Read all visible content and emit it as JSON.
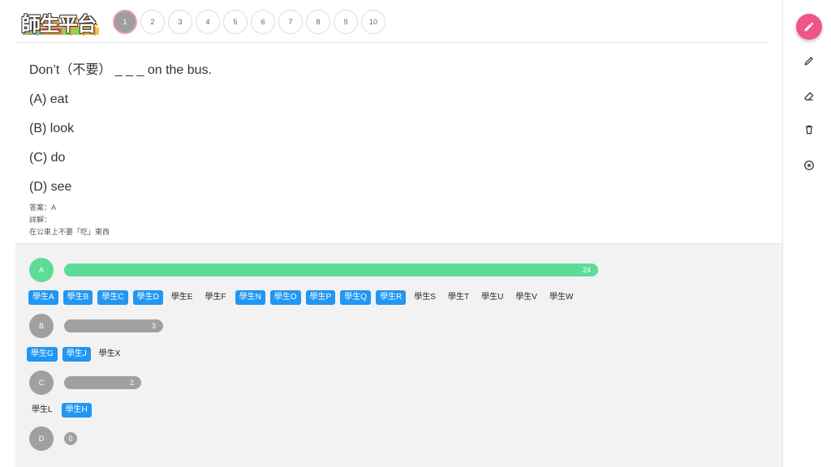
{
  "logo": {
    "text": "師生平台"
  },
  "question_nav": [
    "1",
    "2",
    "3",
    "4",
    "5",
    "6",
    "7",
    "8",
    "9",
    "10"
  ],
  "question": {
    "stem": "Don’t（不要） _ _ _ on the bus.",
    "options": [
      "(A) eat",
      "(B) look",
      "(C) do",
      "(D) see"
    ],
    "answer": "答案：A",
    "explanation_label": "詳解：",
    "explanation": "在公車上不要「吃」東西"
  },
  "results": [
    {
      "option": "A",
      "count": "24",
      "count_value": 24,
      "color": "#5ddc98",
      "students": [
        {
          "name": "學生A",
          "selected": true
        },
        {
          "name": "學生B",
          "selected": true
        },
        {
          "name": "學生C",
          "selected": true
        },
        {
          "name": "學生D",
          "selected": true
        },
        {
          "name": "學生E",
          "selected": false
        },
        {
          "name": "學生F",
          "selected": false
        },
        {
          "name": "學生N",
          "selected": true
        },
        {
          "name": "學生O",
          "selected": true
        },
        {
          "name": "學生P",
          "selected": true
        },
        {
          "name": "學生Q",
          "selected": true
        },
        {
          "name": "學生R",
          "selected": true
        },
        {
          "name": "學生S",
          "selected": false
        },
        {
          "name": "學生T",
          "selected": false
        },
        {
          "name": "學生U",
          "selected": false
        },
        {
          "name": "學生V",
          "selected": false
        },
        {
          "name": "學生W",
          "selected": false
        }
      ]
    },
    {
      "option": "B",
      "count": "3",
      "count_value": 3,
      "color": "#a0a0a0",
      "students": [
        {
          "name": "學生G",
          "selected": true
        },
        {
          "name": "學生J",
          "selected": true
        },
        {
          "name": "學生X",
          "selected": false
        }
      ]
    },
    {
      "option": "C",
      "count": "2",
      "count_value": 2,
      "color": "#a0a0a0",
      "students": [
        {
          "name": "學生L",
          "selected": false
        },
        {
          "name": "學生H",
          "selected": true
        }
      ]
    },
    {
      "option": "D",
      "count": "0",
      "count_value": 0,
      "color": "#a0a0a0",
      "students": []
    }
  ],
  "toolbar": {
    "fab_icon": "pencil-icon",
    "tools": [
      "pen-icon",
      "eraser-icon",
      "trash-icon",
      "close-circle-icon"
    ],
    "accent": "#f0548a"
  }
}
